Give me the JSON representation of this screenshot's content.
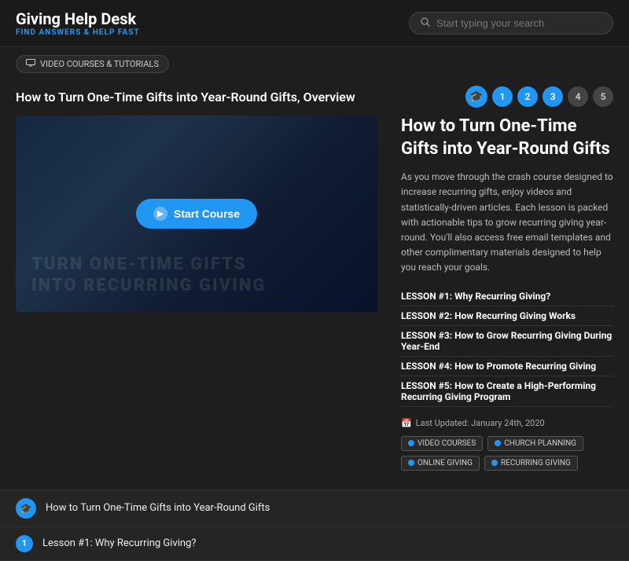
{
  "header": {
    "logo_title": "Giving Help Desk",
    "logo_subtitle": "FIND ANSWERS & HELP FAST",
    "search_placeholder": "Start typing your search"
  },
  "breadcrumb": {
    "label": "VIDEO COURSES & TUTORIALS"
  },
  "page": {
    "title": "How to Turn One-Time Gifts into Year-Round Gifts, Overview"
  },
  "steps": {
    "icon": "🎓",
    "numbers": [
      "1",
      "2",
      "3",
      "4",
      "5"
    ]
  },
  "video": {
    "bg_text": "Turn one-time gifts\ninto recurring giving",
    "start_btn": "Start Course"
  },
  "course": {
    "title": "How to Turn One-Time Gifts into Year-Round Gifts",
    "description": "As you move through the crash course designed to increase recurring gifts, enjoy videos and statistically-driven articles. Each lesson is packed with actionable tips to grow recurring giving year-round. You'll also access free email templates and other complimentary materials designed to help you reach your goals.",
    "lessons": [
      "LESSON #1: Why Recurring Giving?",
      "LESSON #2: How Recurring Giving Works",
      "LESSON #3: How to Grow Recurring Giving During Year-End",
      "LESSON #4: How to Promote Recurring Giving",
      "LESSON #5: How to Create a High-Performing Recurring Giving Program"
    ],
    "last_updated": "Last Updated: January 24th, 2020",
    "tags": [
      "VIDEO COURSES",
      "CHURCH PLANNING",
      "ONLINE GIVING",
      "RECURRING GIVING"
    ]
  },
  "bottom_nav": [
    {
      "type": "icon",
      "label": "How to Turn One-Time Gifts into Year-Round Gifts"
    },
    {
      "type": "number",
      "num": "1",
      "label": "Lesson #1: Why Recurring Giving?"
    }
  ]
}
